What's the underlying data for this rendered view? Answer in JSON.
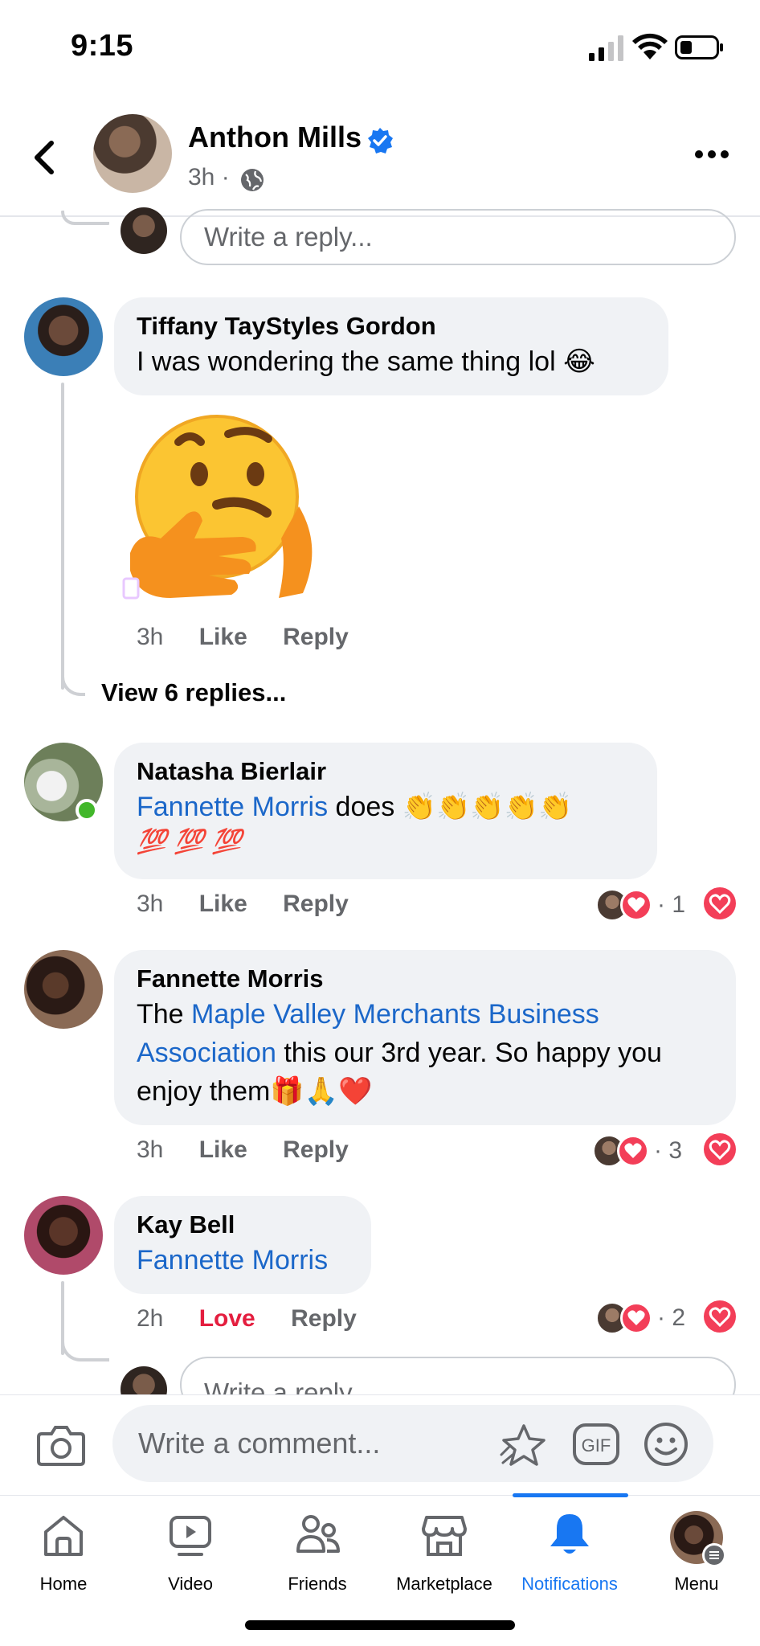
{
  "status_bar": {
    "time": "9:15"
  },
  "header": {
    "name": "Anthon Mills",
    "time": "3h ·"
  },
  "reply_placeholder_top": "Write a reply...",
  "comments": [
    {
      "name": "Tiffany TayStyles Gordon",
      "text": "I was wondering the same thing lol",
      "emoji": "😂",
      "time": "3h",
      "like": "Like",
      "reply": "Reply",
      "sticker": "thinking-face-sticker"
    },
    {
      "name": "Natasha Bierlair",
      "mention": "Fannette Morris",
      "text": " does ",
      "emoji_line1": "👏👏👏👏👏",
      "emoji_line2": "💯 💯 💯",
      "time": "3h",
      "like": "Like",
      "reply": "Reply",
      "reaction_count": "· 1"
    },
    {
      "name": "Fannette Morris",
      "text_prefix": "The ",
      "mention": "Maple Valley Merchants Business Association",
      "text_suffix": " this our 3rd year. So happy you enjoy them",
      "emoji": "🎁🙏❤️",
      "time": "3h",
      "like": "Like",
      "reply": "Reply",
      "reaction_count": "· 3"
    },
    {
      "name": "Kay Bell",
      "mention": "Fannette Morris",
      "time": "2h",
      "like": "Love",
      "reply": "Reply",
      "reaction_count": "· 2"
    }
  ],
  "view_replies": "View 6 replies...",
  "reply_placeholder_bottom": "Write a reply...",
  "composer": {
    "placeholder": "Write a comment..."
  },
  "nav": [
    {
      "label": "Home",
      "icon": "home-icon"
    },
    {
      "label": "Video",
      "icon": "video-icon"
    },
    {
      "label": "Friends",
      "icon": "friends-icon"
    },
    {
      "label": "Marketplace",
      "icon": "marketplace-icon"
    },
    {
      "label": "Notifications",
      "icon": "bell-icon",
      "active": true
    },
    {
      "label": "Menu",
      "icon": "profile-avatar"
    }
  ],
  "colors": {
    "accent": "#1877f2",
    "link": "#1b67c9",
    "love": "#e41e3f",
    "bubble": "#f0f2f5"
  }
}
